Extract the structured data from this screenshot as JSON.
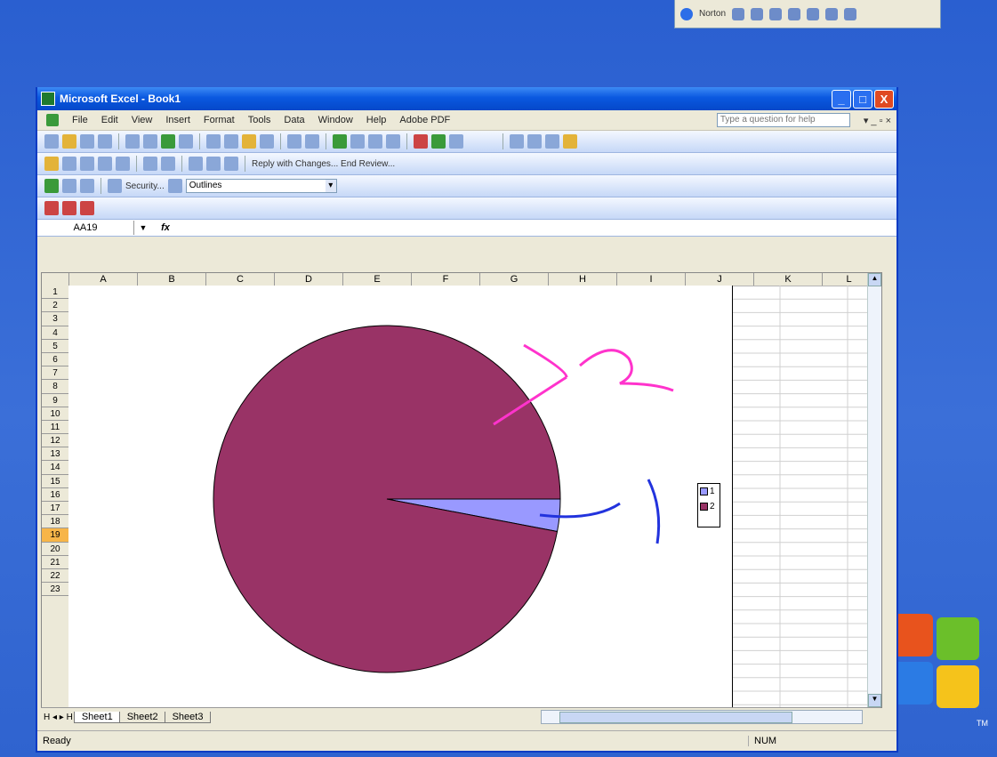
{
  "window": {
    "title": "Microsoft Excel - Book1",
    "title_buttons": [
      "_",
      "□",
      "X"
    ]
  },
  "menubar": {
    "items": [
      "File",
      "Edit",
      "View",
      "Insert",
      "Format",
      "Tools",
      "Data",
      "Window",
      "Help",
      "Adobe PDF"
    ],
    "help_placeholder": "Type a question for help",
    "controls": "▾ _ ▫ ×"
  },
  "toolbar": {
    "reply_text": "Reply with Changes... End Review...",
    "security_label": "Security...",
    "style_value": "Outlines"
  },
  "formula_bar": {
    "name_box": "AA19",
    "fx": "fx"
  },
  "sheet": {
    "columns": [
      "A",
      "B",
      "C",
      "D",
      "E",
      "F",
      "G",
      "H",
      "I",
      "J",
      "K",
      "L"
    ],
    "rows": [
      "1",
      "2",
      "3",
      "4",
      "5",
      "6",
      "7",
      "8",
      "9",
      "10",
      "11",
      "12",
      "13",
      "14",
      "15",
      "16",
      "17",
      "18",
      "19",
      "20",
      "21",
      "22",
      "23"
    ],
    "selected_row": "19"
  },
  "chart_data": {
    "type": "pie",
    "categories": [
      "1",
      "2"
    ],
    "values": [
      3,
      97
    ],
    "colors": [
      "#9999ff",
      "#993366"
    ],
    "annotations": [
      "1",
      "2"
    ],
    "legend_position": "right"
  },
  "tabs": {
    "nav": "H ◂ ▸ H",
    "items": [
      "Sheet1",
      "Sheet2",
      "Sheet3"
    ]
  },
  "status": {
    "text": "Ready",
    "num": "NUM"
  },
  "desktop": {
    "taskbar_label": "Norton",
    "tm": "TM",
    "brand": "Windows XP"
  },
  "colors": {
    "titlebar": "#0a58e0",
    "pie_main": "#993366",
    "pie_slice": "#9999ff",
    "annotation_pink": "#ff33cc",
    "annotation_blue": "#2233dd"
  }
}
